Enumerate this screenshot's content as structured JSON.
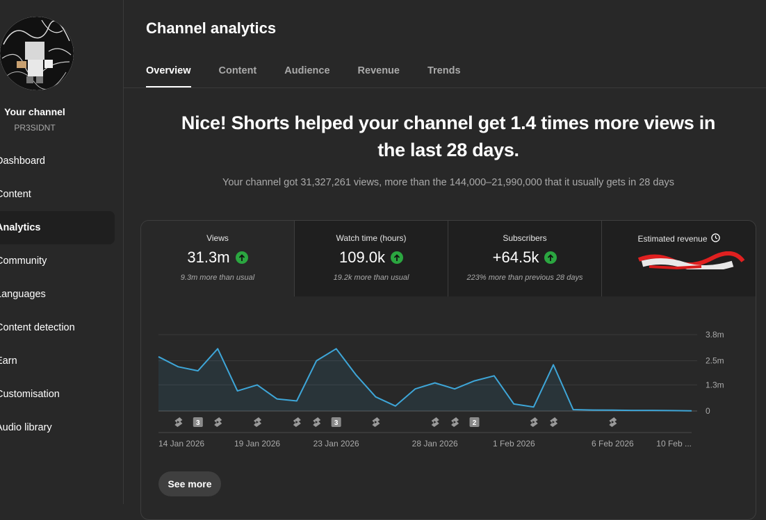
{
  "channel": {
    "name": "Your channel",
    "handle": "PR3SIDNT"
  },
  "sidebar": {
    "items": [
      {
        "label": "Dashboard",
        "active": false
      },
      {
        "label": "Content",
        "active": false
      },
      {
        "label": "Analytics",
        "active": true
      },
      {
        "label": "Community",
        "active": false
      },
      {
        "label": "Languages",
        "active": false
      },
      {
        "label": "Content detection",
        "active": false
      },
      {
        "label": "Earn",
        "active": false
      },
      {
        "label": "Customisation",
        "active": false
      },
      {
        "label": "Audio library",
        "active": false
      }
    ]
  },
  "header": {
    "title": "Channel analytics"
  },
  "tabs": [
    {
      "label": "Overview",
      "active": true
    },
    {
      "label": "Content",
      "active": false
    },
    {
      "label": "Audience",
      "active": false
    },
    {
      "label": "Revenue",
      "active": false
    },
    {
      "label": "Trends",
      "active": false
    }
  ],
  "headline": "Nice! Shorts helped your channel get 1.4 times more views in the last 28 days.",
  "subline": "Your channel got 31,327,261 views, more than the 144,000–21,990,000 that it usually gets in 28 days",
  "metrics": [
    {
      "label": "Views",
      "value": "31.3m",
      "note": "9.3m more than usual",
      "trend": "up"
    },
    {
      "label": "Watch time (hours)",
      "value": "109.0k",
      "note": "19.2k more than usual",
      "trend": "up"
    },
    {
      "label": "Subscribers",
      "value": "+64.5k",
      "note": "223% more than previous 28 days",
      "trend": "up"
    },
    {
      "label": "Estimated revenue",
      "value": "",
      "note": "",
      "trend": "",
      "icon": "clock-icon",
      "redacted": true
    }
  ],
  "colors": {
    "accent_up": "#2ba640",
    "line": "#3ea6d8",
    "background": "#282828"
  },
  "see_more": "See more",
  "chart_data": {
    "type": "area",
    "x": [
      "14 Jan 2026",
      "15 Jan 2026",
      "16 Jan 2026",
      "17 Jan 2026",
      "18 Jan 2026",
      "19 Jan 2026",
      "20 Jan 2026",
      "21 Jan 2026",
      "22 Jan 2026",
      "23 Jan 2026",
      "24 Jan 2026",
      "25 Jan 2026",
      "26 Jan 2026",
      "27 Jan 2026",
      "28 Jan 2026",
      "29 Jan 2026",
      "30 Jan 2026",
      "31 Jan 2026",
      "1 Feb 2026",
      "2 Feb 2026",
      "3 Feb 2026",
      "4 Feb 2026",
      "5 Feb 2026",
      "6 Feb 2026",
      "7 Feb 2026",
      "8 Feb 2026",
      "9 Feb 2026",
      "10 Feb 2026"
    ],
    "values": [
      2.7,
      2.2,
      2.0,
      3.1,
      1.0,
      1.3,
      0.6,
      0.5,
      2.5,
      3.1,
      1.8,
      0.7,
      0.25,
      1.1,
      1.4,
      1.1,
      1.5,
      1.75,
      0.35,
      0.2,
      2.3,
      0.07,
      0.05,
      0.04,
      0.03,
      0.03,
      0.02,
      0.01
    ],
    "series": [
      {
        "name": "Views",
        "unit": "m"
      }
    ],
    "ylim": [
      0,
      3.8
    ],
    "yticks": [
      "3.8m",
      "2.5m",
      "1.3m",
      "0"
    ],
    "ytick_values": [
      3.8,
      2.5,
      1.3,
      0
    ],
    "xtick_labels": [
      "14 Jan 2026",
      "19 Jan 2026",
      "23 Jan 2026",
      "28 Jan 2026",
      "1 Feb 2026",
      "6 Feb 2026",
      "10 Feb ..."
    ],
    "xtick_indices": [
      0,
      5,
      9,
      14,
      18,
      23,
      27
    ],
    "markers": [
      {
        "index": 1,
        "kind": "shorts-icon"
      },
      {
        "index": 2,
        "kind": "count",
        "count": "3"
      },
      {
        "index": 3,
        "kind": "shorts-icon"
      },
      {
        "index": 5,
        "kind": "shorts-icon"
      },
      {
        "index": 7,
        "kind": "shorts-icon"
      },
      {
        "index": 8,
        "kind": "shorts-icon"
      },
      {
        "index": 9,
        "kind": "count",
        "count": "3"
      },
      {
        "index": 11,
        "kind": "shorts-icon"
      },
      {
        "index": 14,
        "kind": "shorts-icon"
      },
      {
        "index": 15,
        "kind": "shorts-icon"
      },
      {
        "index": 16,
        "kind": "count",
        "count": "2"
      },
      {
        "index": 19,
        "kind": "shorts-icon"
      },
      {
        "index": 20,
        "kind": "shorts-icon"
      },
      {
        "index": 23,
        "kind": "shorts-icon"
      }
    ],
    "grid": true
  }
}
